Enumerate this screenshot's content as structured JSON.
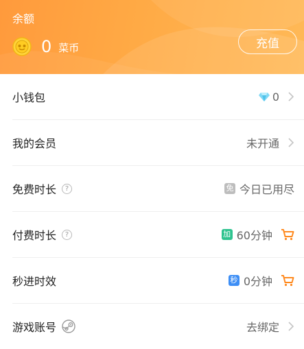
{
  "header": {
    "balance_label": "余额",
    "coin_amount": "0",
    "coin_unit": "菜币",
    "recharge_label": "充值"
  },
  "rows": [
    {
      "label": "小钱包",
      "value": "0",
      "icon": "diamond-icon"
    },
    {
      "label": "我的会员",
      "value": "未开通"
    },
    {
      "label": "免费时长",
      "value": "今日已用尽",
      "badge": "免",
      "badge_color": "#bdbdbd"
    },
    {
      "label": "付费时长",
      "value": "60分钟",
      "badge": "加",
      "badge_color": "#2ec38f"
    },
    {
      "label": "秒进时效",
      "value": "0分钟",
      "badge": "秒",
      "badge_color": "#3d8ef5"
    },
    {
      "label": "游戏账号",
      "value": "去绑定",
      "icon": "steam-icon"
    }
  ],
  "colors": {
    "accent": "#ff9e3d",
    "cart": "#ff8a1f",
    "help_symbol": "?"
  }
}
